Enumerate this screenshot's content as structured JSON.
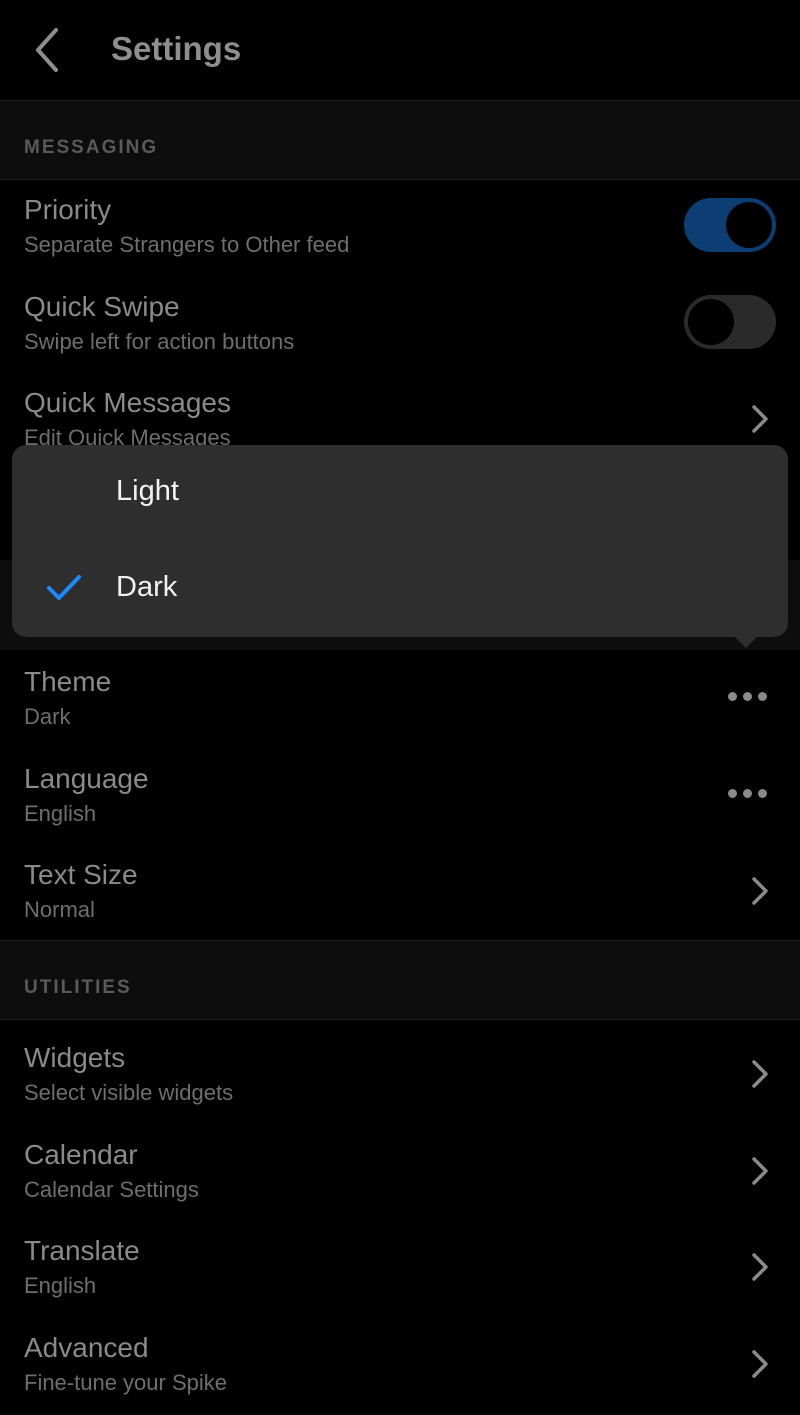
{
  "header": {
    "title": "Settings"
  },
  "sections": {
    "messaging": "MESSAGING",
    "utilities": "UTILITIES"
  },
  "messaging": {
    "priority": {
      "title": "Priority",
      "subtitle": "Separate Strangers to Other feed",
      "toggle_on": true
    },
    "quick_swipe": {
      "title": "Quick Swipe",
      "subtitle": "Swipe left for action buttons",
      "toggle_on": false
    },
    "quick_messages": {
      "title": "Quick Messages",
      "subtitle": "Edit Quick Messages"
    }
  },
  "appearance": {
    "theme": {
      "title": "Theme",
      "subtitle": "Dark"
    },
    "language": {
      "title": "Language",
      "subtitle": "English"
    },
    "text_size": {
      "title": "Text Size",
      "subtitle": "Normal"
    }
  },
  "utilities": {
    "widgets": {
      "title": "Widgets",
      "subtitle": "Select visible widgets"
    },
    "calendar": {
      "title": "Calendar",
      "subtitle": "Calendar Settings"
    },
    "translate": {
      "title": "Translate",
      "subtitle": "English"
    },
    "advanced": {
      "title": "Advanced",
      "subtitle": "Fine-tune your Spike"
    }
  },
  "theme_menu": {
    "options": [
      "Light",
      "Dark"
    ],
    "selected": "Dark"
  },
  "colors": {
    "accent": "#0c3e73",
    "check": "#1a8cff"
  }
}
